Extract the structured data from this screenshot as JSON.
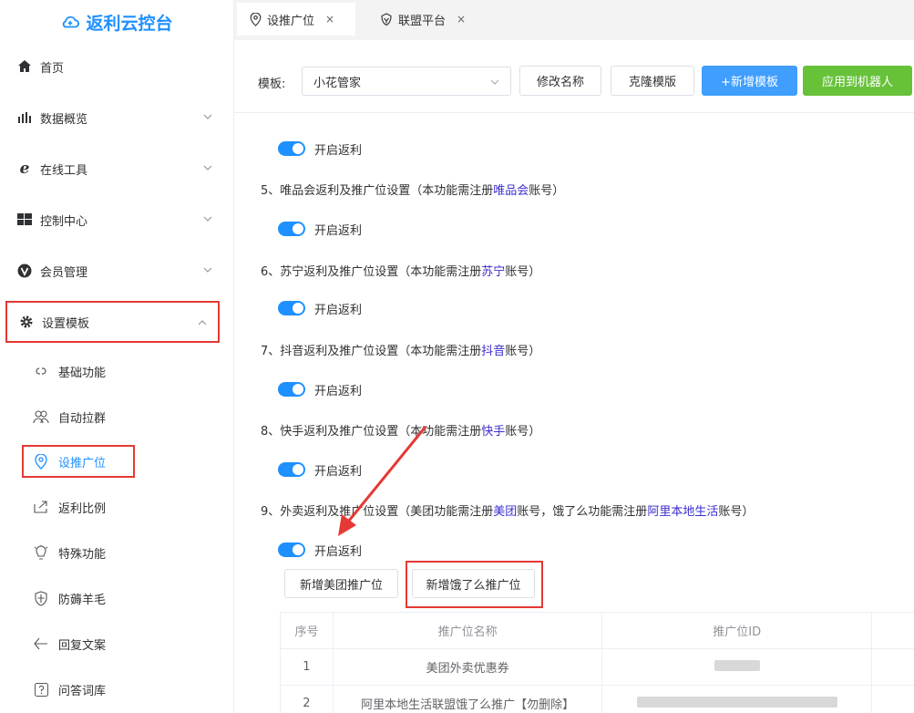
{
  "app": {
    "title": "返利云控台"
  },
  "sidebar": {
    "items": [
      {
        "label": "首页",
        "icon": "home-icon"
      },
      {
        "label": "数据概览",
        "icon": "bar-chart-icon"
      },
      {
        "label": "在线工具",
        "icon": "browser-e-icon"
      },
      {
        "label": "控制中心",
        "icon": "windows-icon"
      },
      {
        "label": "会员管理",
        "icon": "v-badge-icon"
      },
      {
        "label": "设置模板",
        "icon": "gear-icon"
      }
    ],
    "sub_items": [
      {
        "label": "基础功能",
        "icon": "link-icon"
      },
      {
        "label": "自动拉群",
        "icon": "users-icon"
      },
      {
        "label": "设推广位",
        "icon": "location-pin-icon"
      },
      {
        "label": "返利比例",
        "icon": "share-icon"
      },
      {
        "label": "特殊功能",
        "icon": "bulb-icon"
      },
      {
        "label": "防薅羊毛",
        "icon": "shield-icon"
      },
      {
        "label": "回复文案",
        "icon": "reply-icon"
      },
      {
        "label": "问答词库",
        "icon": "question-icon"
      }
    ]
  },
  "tabs": [
    {
      "label": "设推广位",
      "close": "×"
    },
    {
      "label": "联盟平台",
      "close": "×"
    }
  ],
  "toolbar": {
    "template_label": "模板:",
    "template_value": "小花管家",
    "rename_label": "修改名称",
    "clone_label": "克隆模版",
    "add_label": "+新增模板",
    "apply_label": "应用到机器人"
  },
  "sections": {
    "switch_label": "开启返利",
    "s5": {
      "pre": "5、唯品会返利及推广位设置（本功能需注册",
      "link": "唯品会",
      "post": "账号）"
    },
    "s6": {
      "pre": "6、苏宁返利及推广位设置（本功能需注册",
      "link": "苏宁",
      "post": "账号）"
    },
    "s7": {
      "pre": "7、抖音返利及推广位设置（本功能需注册",
      "link": "抖音",
      "post": "账号）"
    },
    "s8": {
      "pre": "8、快手返利及推广位设置（本功能需注册",
      "link": "快手",
      "post": "账号）"
    },
    "s9": {
      "pre": "9、外卖返利及推广位设置（美团功能需注册",
      "link1": "美团",
      "mid": "账号，饿了么功能需注册",
      "link2": "阿里本地生活",
      "post": "账号）"
    }
  },
  "buttons": {
    "add_meituan": "新增美团推广位",
    "add_eleme": "新增饿了么推广位"
  },
  "table": {
    "headers": [
      "序号",
      "推广位名称",
      "推广位ID"
    ],
    "rows": [
      {
        "no": "1",
        "name": "美团外卖优惠券"
      },
      {
        "no": "2",
        "name": "阿里本地生活联盟饿了么推广【勿删除】"
      }
    ]
  },
  "colors": {
    "accent": "#409eff",
    "success": "#67c23a",
    "highlight": "#e53935"
  }
}
